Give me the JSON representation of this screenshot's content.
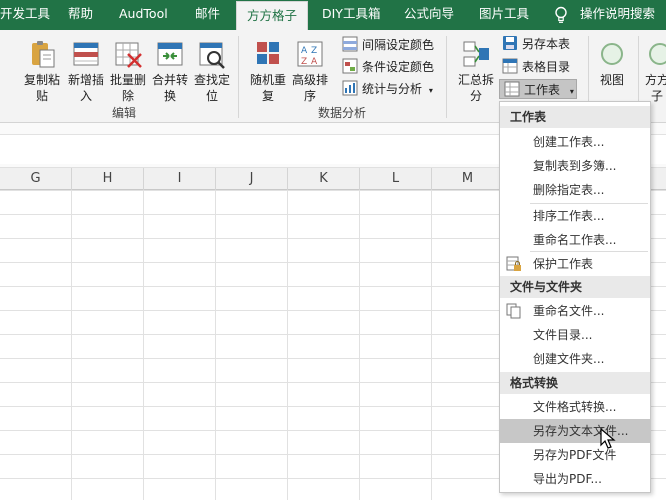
{
  "tabs": {
    "developer": "开发工具",
    "help": "帮助",
    "audtool": "AudTool",
    "mail": "邮件",
    "fangfang": "方方格子",
    "diy": "DIY工具箱",
    "formula": "公式向导",
    "image": "图片工具",
    "tell_me": "操作说明搜索"
  },
  "ribbon": {
    "edit": {
      "copy_paste": "复制粘\n贴",
      "insert_new": "新增插\n入",
      "batch_delete": "批量删\n除",
      "merge_convert": "合并转\n换",
      "find_locate": "查找定\n位",
      "label": "编辑"
    },
    "data_analysis": {
      "random_repeat": "随机重\n复",
      "advanced_sort": "高级排\n序",
      "interval_color": "间隔设定颜色",
      "conditional_color": "条件设定颜色",
      "statistics": "统计与分析",
      "label": "数据分析"
    },
    "summary": "汇总拆\n分",
    "save_copy": "另存本表",
    "table_dir": "表格目录",
    "worksheet": "工作表",
    "view": "视图",
    "fangfang_partial": "方方\n子"
  },
  "columns": [
    "G",
    "H",
    "I",
    "J",
    "K",
    "L",
    "M"
  ],
  "menu": {
    "header_worksheet": "工作表",
    "create_sheets": "创建工作表...",
    "copy_to_many": "复制表到多簿...",
    "delete_sheets": "删除指定表...",
    "sort_sheets": "排序工作表...",
    "rename_sheets": "重命名工作表...",
    "protect_sheets": "保护工作表",
    "header_files": "文件与文件夹",
    "rename_files": "重命名文件...",
    "file_dir": "文件目录...",
    "create_folder": "创建文件夹...",
    "header_convert": "格式转换",
    "format_convert": "文件格式转换...",
    "save_as_text": "另存为文本文件...",
    "save_as_pdf": "另存为PDF文件",
    "export_pdf": "导出为PDF..."
  },
  "colors": {
    "tab_bar": "#217346",
    "highlight": "#c7c7c7"
  }
}
